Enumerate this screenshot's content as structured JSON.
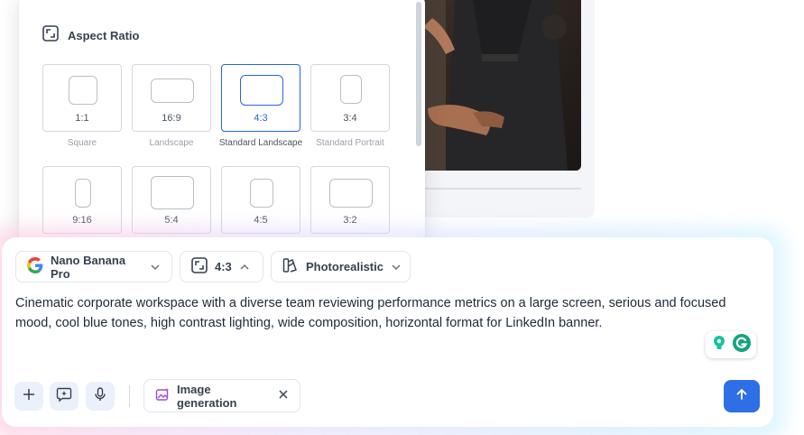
{
  "aspect_panel": {
    "title": "Aspect Ratio",
    "options": [
      {
        "ratio": "1:1",
        "caption": "Square",
        "selected": false
      },
      {
        "ratio": "16:9",
        "caption": "Landscape",
        "selected": false
      },
      {
        "ratio": "4:3",
        "caption": "Standard Landscape",
        "selected": true
      },
      {
        "ratio": "3:4",
        "caption": "Standard Portrait",
        "selected": false
      },
      {
        "ratio": "9:16",
        "caption": "",
        "selected": false
      },
      {
        "ratio": "5:4",
        "caption": "",
        "selected": false
      },
      {
        "ratio": "4:5",
        "caption": "",
        "selected": false
      },
      {
        "ratio": "3:2",
        "caption": "",
        "selected": false
      }
    ]
  },
  "composer": {
    "model_label": "Nano Banana Pro",
    "aspect_label": "4:3",
    "style_label": "Photorealistic",
    "prompt": "Cinematic corporate workspace with a diverse team reviewing performance metrics on a large screen, serious and focused mood, cool blue tones, high contrast lighting, wide composition, horizontal format for LinkedIn banner.",
    "mode_chip_label": "Image generation"
  },
  "colors": {
    "accent": "#2563eb",
    "send_button": "#2f6fe6",
    "tool_button_bg": "#eaf1fb",
    "grammarly": "#15c39a"
  },
  "icons": {
    "aspect_header": "aspect-ratio-icon",
    "model": "google-g-icon",
    "style": "style-brush-icon",
    "add": "plus-icon",
    "spark": "sparkle-box-icon",
    "mic": "microphone-icon",
    "mode": "image-sparkle-icon",
    "close": "close-icon",
    "send": "arrow-up-icon"
  }
}
